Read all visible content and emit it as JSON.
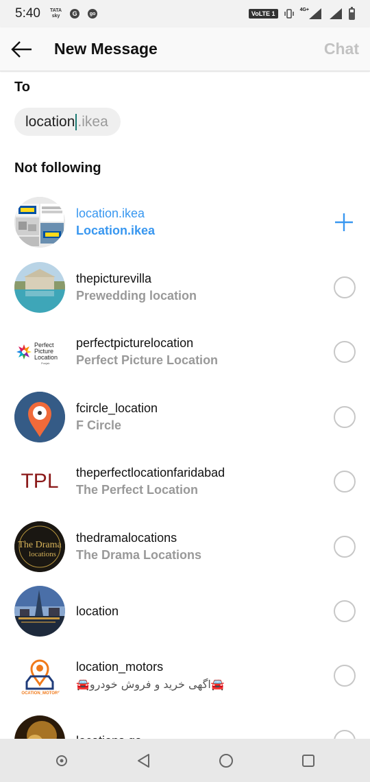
{
  "status_bar": {
    "time": "5:40",
    "carrier_line1": "TATA",
    "carrier_line2": "sky",
    "app_icon_1": "G",
    "app_icon_2": "go",
    "volte": "VoLTE 1",
    "network": "4G+"
  },
  "header": {
    "back_icon": "arrow-left-icon",
    "title": "New Message",
    "chat_label": "Chat"
  },
  "to": {
    "label": "To",
    "typed": "location",
    "suggestion": ".ikea"
  },
  "section_title": "Not following",
  "results": [
    {
      "username": "location.ikea",
      "fullname": "Location.ikea",
      "selected": true
    },
    {
      "username": "thepicturevilla",
      "fullname": "Prewedding location",
      "selected": false
    },
    {
      "username": "perfectpicturelocation",
      "fullname": "Perfect Picture Location",
      "selected": false,
      "avatar_text": [
        "Perfect",
        "Picture",
        "Location",
        "Punjab"
      ]
    },
    {
      "username": "fcircle_location",
      "fullname": "F Circle",
      "selected": false
    },
    {
      "username": "theperfectlocationfaridabad",
      "fullname": "The Perfect Location",
      "selected": false,
      "avatar_text": [
        "TPL"
      ]
    },
    {
      "username": "thedramalocations",
      "fullname": "The Drama Locations",
      "selected": false,
      "avatar_text": [
        "The Drama",
        "locations"
      ]
    },
    {
      "username": "location",
      "fullname": "",
      "selected": false
    },
    {
      "username": "location_motors",
      "fullname": "🚘اگهی خرید و فروش خودرو🚘",
      "selected": false,
      "avatar_text": [
        "LOCATION_MOTORS"
      ]
    },
    {
      "username": "locations.qa",
      "fullname": "",
      "selected": false
    }
  ],
  "ikea_logo_text": "IKEA",
  "nav": {
    "left_icon": "assistant-dot-icon",
    "back_icon": "nav-back-triangle-icon",
    "home_icon": "nav-home-circle-icon",
    "recents_icon": "nav-recents-square-icon"
  },
  "colors": {
    "accent": "#3897f0",
    "caret": "#1a7a73",
    "muted": "#999999"
  }
}
